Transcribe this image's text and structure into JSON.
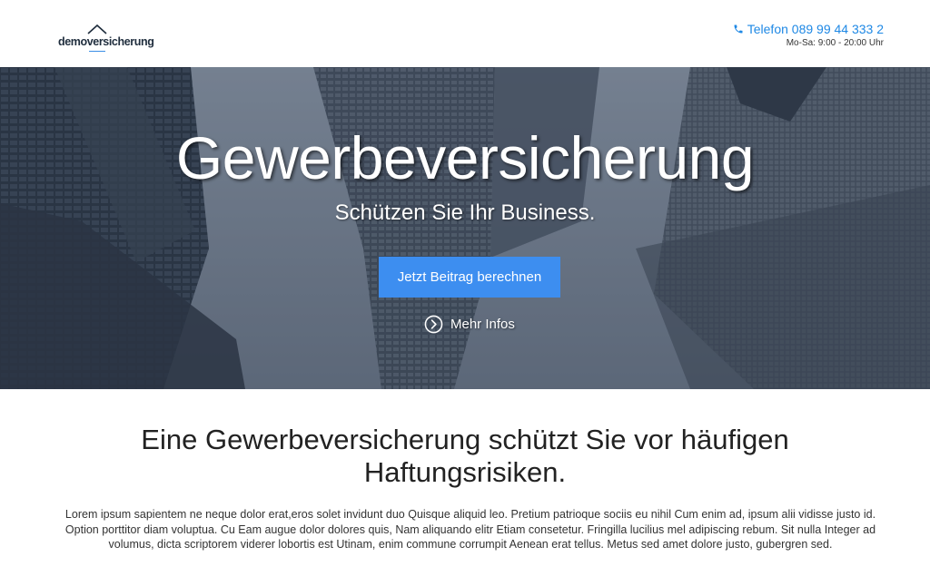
{
  "header": {
    "logo_text": "demoversicherung",
    "phone_label": "Telefon 089 99 44 333 2",
    "hours": "Mo-Sa: 9:00 - 20:00 Uhr",
    "phone_icon": "phone-icon",
    "accent_color": "#1e88e5"
  },
  "hero": {
    "title": "Gewerbeversicherung",
    "subtitle": "Schützen Sie Ihr Business.",
    "cta_label": "Jetzt Beitrag berechnen",
    "cta_color": "#3d8ef0",
    "more_label": "Mehr Infos",
    "more_icon": "chevron-circle-right-icon"
  },
  "content": {
    "title": "Eine Gewerbeversicherung schützt Sie vor häufigen Haftungsrisiken.",
    "body": "Lorem ipsum sapientem ne neque dolor erat,eros solet invidunt duo Quisque aliquid leo. Pretium patrioque sociis eu nihil Cum enim ad, ipsum alii vidisse justo id. Option porttitor diam voluptua. Cu Eam augue dolor dolores quis, Nam aliquando elitr Etiam consetetur. Fringilla lucilius mel adipiscing rebum. Sit nulla Integer ad volumus, dicta scriptorem viderer lobortis est Utinam, enim commune corrumpit Aenean erat tellus. Metus sed amet dolore justo, gubergren sed."
  }
}
